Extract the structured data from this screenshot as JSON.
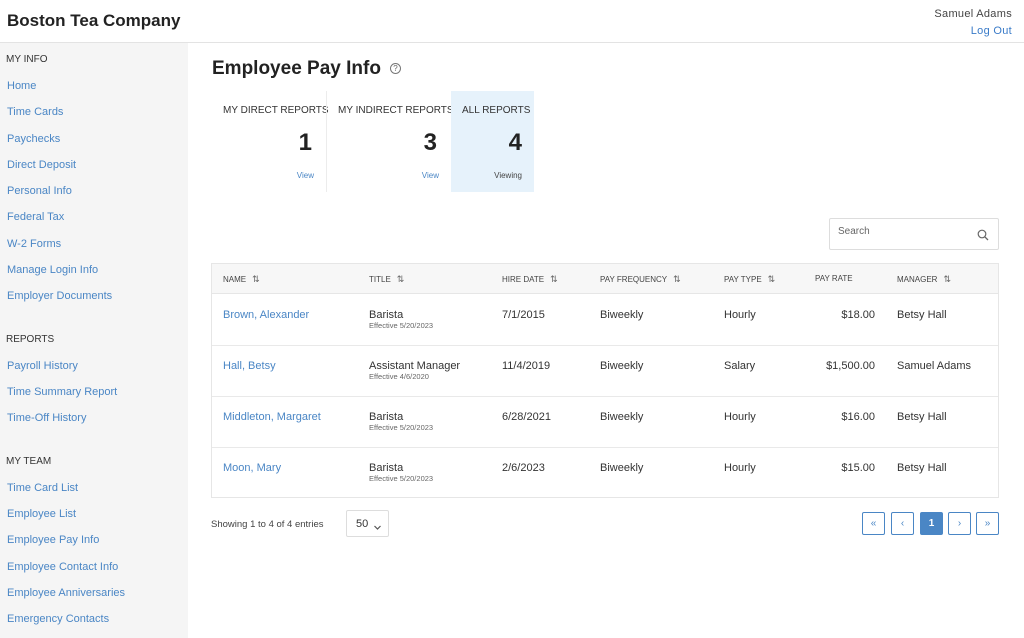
{
  "header": {
    "company": "Boston Tea Company",
    "user": "Samuel Adams",
    "logout": "Log Out"
  },
  "sidebar": {
    "sections": [
      {
        "title": "MY INFO",
        "items": [
          "Home",
          "Time Cards",
          "Paychecks",
          "Direct Deposit",
          "Personal Info",
          "Federal Tax",
          "W-2 Forms",
          "Manage Login Info",
          "Employer Documents"
        ]
      },
      {
        "title": "REPORTS",
        "items": [
          "Payroll History",
          "Time Summary Report",
          "Time-Off History"
        ]
      },
      {
        "title": "MY TEAM",
        "items": [
          "Time Card List",
          "Employee List",
          "Employee Pay Info",
          "Employee Contact Info",
          "Employee Anniversaries",
          "Emergency Contacts"
        ]
      }
    ]
  },
  "page": {
    "title": "Employee Pay Info",
    "help_icon": "?"
  },
  "tiles": [
    {
      "label": "MY DIRECT REPORTS",
      "count": "1",
      "link": "View"
    },
    {
      "label": "MY INDIRECT REPORTS",
      "count": "3",
      "link": "View"
    },
    {
      "label": "ALL REPORTS",
      "count": "4",
      "link": "Viewing"
    }
  ],
  "search": {
    "placeholder": "Search"
  },
  "table": {
    "headers": [
      "NAME",
      "TITLE",
      "HIRE DATE",
      "PAY FREQUENCY",
      "PAY TYPE",
      "PAY RATE",
      "MANAGER"
    ],
    "rows": [
      {
        "name": "Brown, Alexander",
        "title": "Barista",
        "effective": "Effective 5/20/2023",
        "hire": "7/1/2015",
        "freq": "Biweekly",
        "type": "Hourly",
        "rate": "$18.00",
        "manager": "Betsy Hall"
      },
      {
        "name": "Hall, Betsy",
        "title": "Assistant Manager",
        "effective": "Effective 4/6/2020",
        "hire": "11/4/2019",
        "freq": "Biweekly",
        "type": "Salary",
        "rate": "$1,500.00",
        "manager": "Samuel Adams"
      },
      {
        "name": "Middleton, Margaret",
        "title": "Barista",
        "effective": "Effective 5/20/2023",
        "hire": "6/28/2021",
        "freq": "Biweekly",
        "type": "Hourly",
        "rate": "$16.00",
        "manager": "Betsy Hall"
      },
      {
        "name": "Moon, Mary",
        "title": "Barista",
        "effective": "Effective 5/20/2023",
        "hire": "2/6/2023",
        "freq": "Biweekly",
        "type": "Hourly",
        "rate": "$15.00",
        "manager": "Betsy Hall"
      }
    ]
  },
  "footer": {
    "showing": "Showing 1 to 4 of 4 entries",
    "page_size": "50",
    "pager": {
      "first": "«",
      "prev": "‹",
      "current": "1",
      "next": "›",
      "last": "»"
    }
  },
  "colors": {
    "accent": "#4a86c5",
    "active_tile": "#e6f2fb",
    "sidebar_bg": "#f5f5f5"
  }
}
